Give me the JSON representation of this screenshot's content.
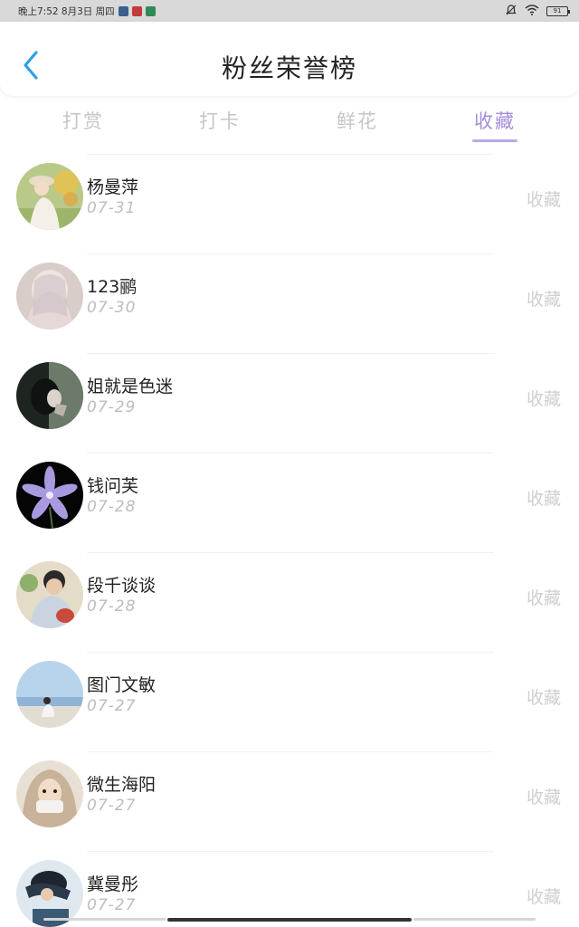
{
  "status_bar": {
    "time_date": "晚上7:52 8月3日 周四",
    "battery": "91",
    "icons": [
      "app-icon-1",
      "app-icon-2",
      "app-icon-3",
      "mute-icon",
      "wifi-icon",
      "battery-icon"
    ]
  },
  "header": {
    "title": "粉丝荣誉榜",
    "back_icon": "chevron-left-icon",
    "back_color": "#2f9ee8"
  },
  "tabs": [
    {
      "label": "打赏",
      "active": false
    },
    {
      "label": "打卡",
      "active": false
    },
    {
      "label": "鲜花",
      "active": false
    },
    {
      "label": "收藏",
      "active": true
    }
  ],
  "accent_color": "#a48ee0",
  "list": [
    {
      "name": "杨曼萍",
      "date": "07-31",
      "type": "收藏"
    },
    {
      "name": "123鹂",
      "date": "07-30",
      "type": "收藏"
    },
    {
      "name": "姐就是色迷",
      "date": "07-29",
      "type": "收藏"
    },
    {
      "name": "钱问芙",
      "date": "07-28",
      "type": "收藏"
    },
    {
      "name": "段千谈谈",
      "date": "07-28",
      "type": "收藏"
    },
    {
      "name": "图门文敏",
      "date": "07-27",
      "type": "收藏"
    },
    {
      "name": "微生海阳",
      "date": "07-27",
      "type": "收藏"
    },
    {
      "name": "冀曼彤",
      "date": "07-27",
      "type": "收藏"
    }
  ]
}
